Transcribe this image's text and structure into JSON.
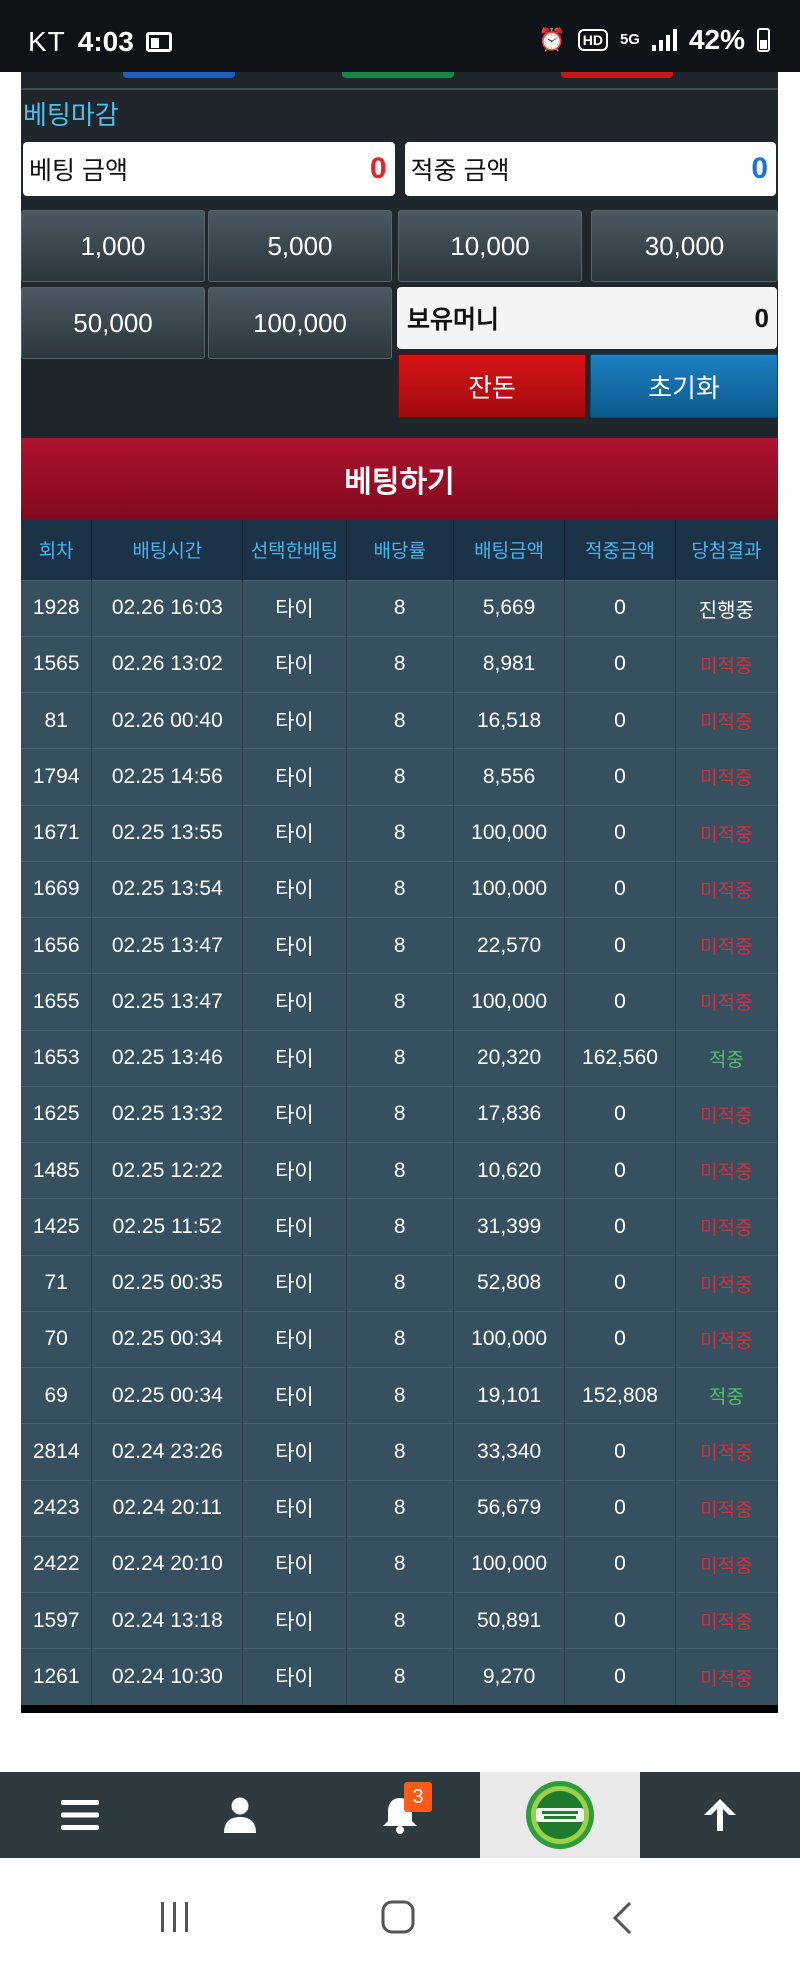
{
  "status_bar": {
    "carrier": "KT",
    "time": "4:03",
    "network": "5G",
    "hd": "HD",
    "battery": "42%"
  },
  "betting": {
    "closing_label": "베팅마감",
    "bet_amount_label": "베팅 금액",
    "bet_amount_value": "0",
    "hit_amount_label": "적중 금액",
    "hit_amount_value": "0",
    "chips": [
      "1,000",
      "5,000",
      "10,000",
      "30,000",
      "50,000",
      "100,000"
    ],
    "money_label": "보유머니",
    "money_value": "0",
    "change_label": "잔돈",
    "reset_label": "초기화",
    "bet_button_label": "베팅하기"
  },
  "history": {
    "columns": [
      "회차",
      "배팅시간",
      "선택한배팅",
      "배당률",
      "배팅금액",
      "적중금액",
      "당첨결과"
    ],
    "rows": [
      [
        "1928",
        "02.26 16:03",
        "타이",
        "8",
        "5,669",
        "0",
        "진행중"
      ],
      [
        "1565",
        "02.26 13:02",
        "타이",
        "8",
        "8,981",
        "0",
        "미적중"
      ],
      [
        "81",
        "02.26 00:40",
        "타이",
        "8",
        "16,518",
        "0",
        "미적중"
      ],
      [
        "1794",
        "02.25 14:56",
        "타이",
        "8",
        "8,556",
        "0",
        "미적중"
      ],
      [
        "1671",
        "02.25 13:55",
        "타이",
        "8",
        "100,000",
        "0",
        "미적중"
      ],
      [
        "1669",
        "02.25 13:54",
        "타이",
        "8",
        "100,000",
        "0",
        "미적중"
      ],
      [
        "1656",
        "02.25 13:47",
        "타이",
        "8",
        "22,570",
        "0",
        "미적중"
      ],
      [
        "1655",
        "02.25 13:47",
        "타이",
        "8",
        "100,000",
        "0",
        "미적중"
      ],
      [
        "1653",
        "02.25 13:46",
        "타이",
        "8",
        "20,320",
        "162,560",
        "적중"
      ],
      [
        "1625",
        "02.25 13:32",
        "타이",
        "8",
        "17,836",
        "0",
        "미적중"
      ],
      [
        "1485",
        "02.25 12:22",
        "타이",
        "8",
        "10,620",
        "0",
        "미적중"
      ],
      [
        "1425",
        "02.25 11:52",
        "타이",
        "8",
        "31,399",
        "0",
        "미적중"
      ],
      [
        "71",
        "02.25 00:35",
        "타이",
        "8",
        "52,808",
        "0",
        "미적중"
      ],
      [
        "70",
        "02.25 00:34",
        "타이",
        "8",
        "100,000",
        "0",
        "미적중"
      ],
      [
        "69",
        "02.25 00:34",
        "타이",
        "8",
        "19,101",
        "152,808",
        "적중"
      ],
      [
        "2814",
        "02.24 23:26",
        "타이",
        "8",
        "33,340",
        "0",
        "미적중"
      ],
      [
        "2423",
        "02.24 20:11",
        "타이",
        "8",
        "56,679",
        "0",
        "미적중"
      ],
      [
        "2422",
        "02.24 20:10",
        "타이",
        "8",
        "100,000",
        "0",
        "미적중"
      ],
      [
        "1597",
        "02.24 13:18",
        "타이",
        "8",
        "50,891",
        "0",
        "미적중"
      ],
      [
        "1261",
        "02.24 10:30",
        "타이",
        "8",
        "9,270",
        "0",
        "미적중"
      ]
    ]
  },
  "bottom_nav": {
    "items": [
      "menu-icon",
      "user-icon",
      "bell-icon",
      "daumo-casino-logo",
      "arrow-up-icon"
    ],
    "notification_count": "3"
  },
  "colors": {
    "accent_blue": "#4cc1f0",
    "bet_red": "#b0122e",
    "lose_red": "#d42f3d",
    "win_green": "#4ec26a"
  }
}
